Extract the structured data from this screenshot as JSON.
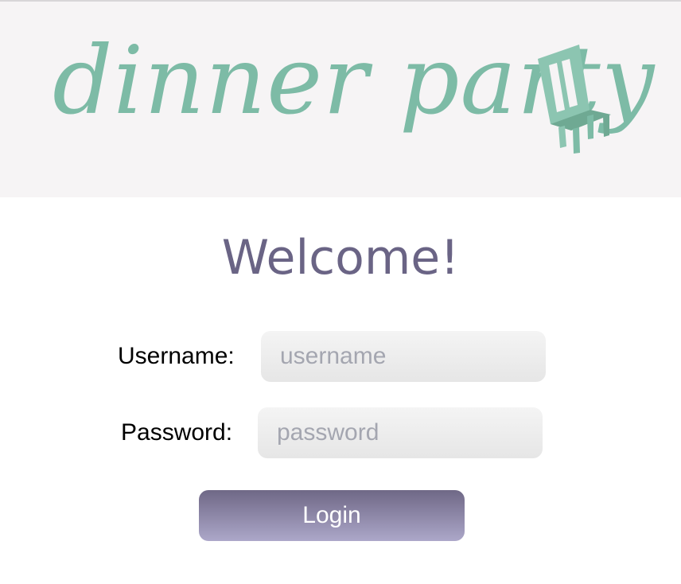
{
  "header": {
    "logo_text": "dinner party",
    "logo_icon": "chair-icon",
    "background": "#f6f4f5",
    "brand_color": "#7dbba6"
  },
  "main": {
    "welcome": "Welcome!",
    "username": {
      "label": "Username:",
      "placeholder": "username",
      "value": ""
    },
    "password": {
      "label": "Password:",
      "placeholder": "password",
      "value": ""
    },
    "login_label": "Login",
    "accent_color": "#6a6485"
  }
}
